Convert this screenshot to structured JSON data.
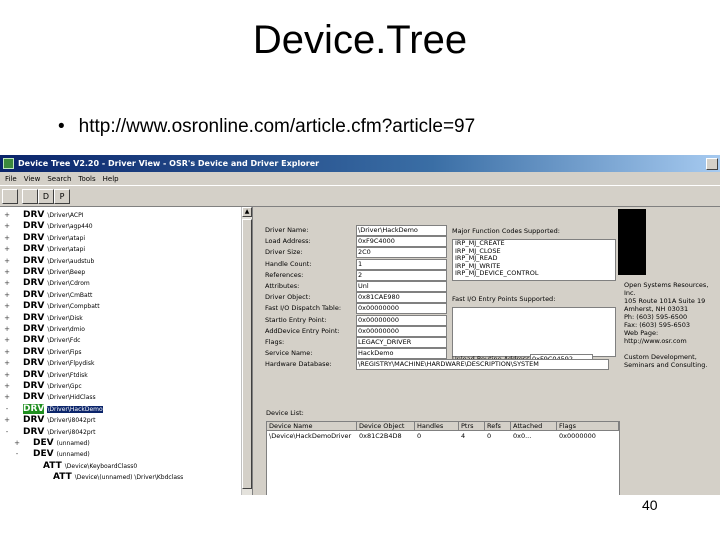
{
  "slide": {
    "title": "Device.Tree",
    "bullet": "http://www.osronline.com/article.cfm?article=97",
    "page_number": "40"
  },
  "app": {
    "window_title": "Device Tree V2.20 - Driver View - OSR's Device and Driver Explorer",
    "menu": [
      "File",
      "View",
      "Search",
      "Tools",
      "Help"
    ],
    "toolbar_buttons": [
      "D",
      "P"
    ],
    "tree": [
      {
        "type": "DRV",
        "path": "\\Driver\\ACPI",
        "expander": "+"
      },
      {
        "type": "DRV",
        "path": "\\Driver\\agp440",
        "expander": "+"
      },
      {
        "type": "DRV",
        "path": "\\Driver\\atapi",
        "expander": "+"
      },
      {
        "type": "DRV",
        "path": "\\Driver\\atapi",
        "expander": "+"
      },
      {
        "type": "DRV",
        "path": "\\Driver\\audstub",
        "expander": "+"
      },
      {
        "type": "DRV",
        "path": "\\Driver\\Beep",
        "expander": "+"
      },
      {
        "type": "DRV",
        "path": "\\Driver\\Cdrom",
        "expander": "+"
      },
      {
        "type": "DRV",
        "path": "\\Driver\\CmBatt",
        "expander": "+"
      },
      {
        "type": "DRV",
        "path": "\\Driver\\Compbatt",
        "expander": "+"
      },
      {
        "type": "DRV",
        "path": "\\Driver\\Disk",
        "expander": "+"
      },
      {
        "type": "DRV",
        "path": "\\Driver\\dmio",
        "expander": "+"
      },
      {
        "type": "DRV",
        "path": "\\Driver\\Fdc",
        "expander": "+"
      },
      {
        "type": "DRV",
        "path": "\\Driver\\Fips",
        "expander": "+"
      },
      {
        "type": "DRV",
        "path": "\\Driver\\Flpydisk",
        "expander": "+"
      },
      {
        "type": "DRV",
        "path": "\\Driver\\Ftdisk",
        "expander": "+"
      },
      {
        "type": "DRV",
        "path": "\\Driver\\Gpc",
        "expander": "+"
      },
      {
        "type": "DRV",
        "path": "\\Driver\\HidClass",
        "expander": "+"
      },
      {
        "type": "DRV",
        "path": "\\Driver\\HackDemo",
        "expander": "-",
        "selected": true
      },
      {
        "type": "DRV",
        "path": "\\Driver\\i8042prt",
        "expander": "+"
      },
      {
        "type": "DRV",
        "path": "\\Driver\\i8042prt",
        "expander": "-"
      },
      {
        "type": "DEV",
        "path": "(unnamed)",
        "expander": "+",
        "indent": 1
      },
      {
        "type": "DEV",
        "path": "(unnamed)",
        "expander": "-",
        "indent": 1
      },
      {
        "type": "ATT",
        "path": "\\Device\\KeyboardClass0",
        "expander": "",
        "indent": 2
      },
      {
        "type": "ATT",
        "path": "\\Device\\(unnamed) \\Driver\\Kbdclass",
        "expander": "",
        "indent": 3
      }
    ],
    "properties": [
      {
        "label": "Driver Name:",
        "value": "\\Driver\\HackDemo"
      },
      {
        "label": "Load Address:",
        "value": "0xF9C4000"
      },
      {
        "label": "Driver Size:",
        "value": "2C0"
      },
      {
        "label": "Handle Count:",
        "value": "1"
      },
      {
        "label": "References:",
        "value": "2"
      },
      {
        "label": "Attributes:",
        "value": "Unl"
      },
      {
        "label": "Driver Object:",
        "value": "0x81CAE980"
      },
      {
        "label": "Fast I/O Dispatch Table:",
        "value": "0x00000000"
      },
      {
        "label": "StartIo Entry Point:",
        "value": "0x00000000"
      },
      {
        "label": "AddDevice Entry Point:",
        "value": "0x00000000"
      },
      {
        "label": "Flags:",
        "value": "LEGACY_DRIVER"
      },
      {
        "label": "Service Name:",
        "value": "HackDemo"
      },
      {
        "label": "Hardware Database:",
        "value": "\\REGISTRY\\MACHINE\\HARDWARE\\DESCRIPTION\\SYSTEM"
      }
    ],
    "major_functions_label": "Major Function Codes Supported:",
    "major_functions": [
      "IRP_MJ_CREATE",
      "IRP_MJ_CLOSE",
      "IRP_MJ_READ",
      "IRP_MJ_WRITE",
      "IRP_MJ_DEVICE_CONTROL"
    ],
    "fast_io_label": "Fast I/O Entry Points Supported:",
    "unload_label": "Unload Routine Address:",
    "unload_value": "0xF9C04592",
    "credits": [
      "Open Systems Resources,",
      "Inc.",
      "105 Route 101A Suite 19",
      "Amherst, NH 03031",
      "Ph: (603) 595-6500",
      "Fax: (603) 595-6503",
      "Web Page:",
      "http://www.osr.com",
      "",
      "Custom Development,",
      "Seminars and Consulting."
    ],
    "device_list": {
      "label": "Device List:",
      "columns": [
        "Device Name",
        "Device Object",
        "Handles",
        "Ptrs",
        "Refs",
        "Attached",
        "Flags"
      ],
      "rows": [
        [
          "\\Device\\HackDemoDriver",
          "0x81C2B4D8",
          "0",
          "4",
          "0",
          "0x0...",
          "0x0000000"
        ]
      ]
    }
  }
}
